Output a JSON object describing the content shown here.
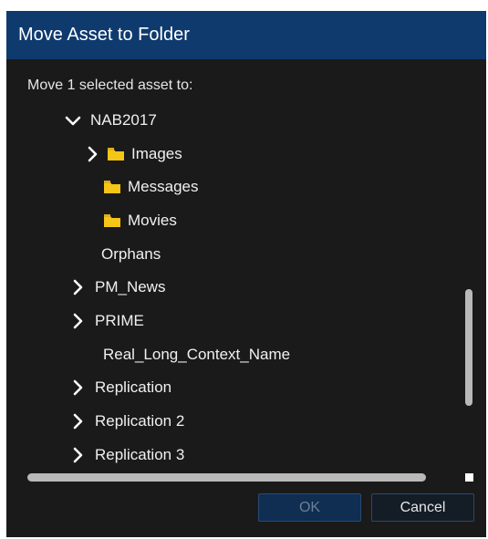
{
  "dialog": {
    "title": "Move Asset to Folder",
    "prompt": "Move 1 selected asset to:",
    "colors": {
      "titlebar": "#0e3a6e",
      "background": "#1a1a1a",
      "folder": "#f5c518"
    }
  },
  "tree": {
    "items": [
      {
        "label": "NAB2017",
        "expander": "chevron-down-icon",
        "folder": false
      },
      {
        "label": "Images",
        "expander": "chevron-right-icon",
        "folder": true
      },
      {
        "label": "Messages",
        "expander": "",
        "folder": true
      },
      {
        "label": "Movies",
        "expander": "",
        "folder": true
      },
      {
        "label": "Orphans",
        "expander": "",
        "folder": false
      },
      {
        "label": "PM_News",
        "expander": "chevron-right-icon",
        "folder": false
      },
      {
        "label": "PRIME",
        "expander": "chevron-right-icon",
        "folder": false
      },
      {
        "label": "Real_Long_Context_Name",
        "expander": "",
        "folder": false
      },
      {
        "label": "Replication",
        "expander": "chevron-right-icon",
        "folder": false
      },
      {
        "label": "Replication 2",
        "expander": "chevron-right-icon",
        "folder": false
      },
      {
        "label": "Replication 3",
        "expander": "chevron-right-icon",
        "folder": false
      }
    ]
  },
  "buttons": {
    "ok_label": "OK",
    "cancel_label": "Cancel",
    "ok_disabled": true
  }
}
